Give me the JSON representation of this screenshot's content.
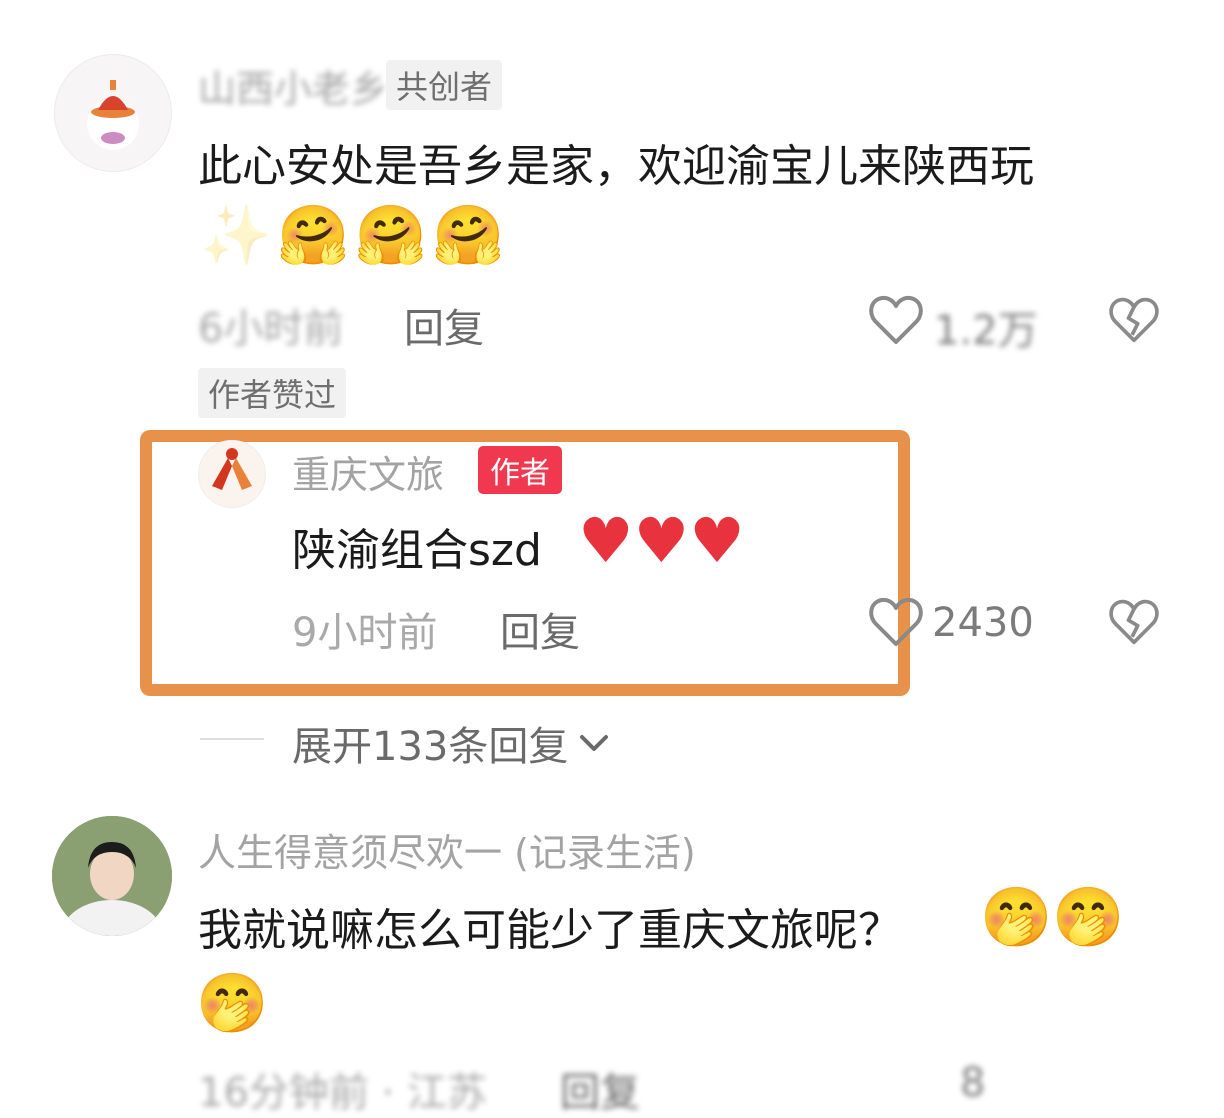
{
  "comments": [
    {
      "username": "山西小老乡",
      "tag": "共创者",
      "text": "此心安处是吾乡是家，欢迎渝宝儿来陕西玩",
      "time": "6小时前",
      "reply_label": "回复",
      "like_count": "1.2万",
      "liked_label": "作者赞过"
    },
    {
      "username": "重庆文旅",
      "tag": "作者",
      "text": "陕渝组合szd",
      "time": "9小时前",
      "reply_label": "回复",
      "like_count": "2430",
      "expand_label": "展开133条回复"
    },
    {
      "username": "人生得意须尽欢一 (记录生活)",
      "text": "我就说嘛怎么可能少了重庆文旅呢？",
      "time": "16分钟前 · 江苏",
      "reply_label": "回复",
      "like_count": "8"
    }
  ],
  "icons": {
    "like": "heart-outline-icon",
    "dislike": "broken-heart-icon",
    "chevron": "chevron-down-icon"
  },
  "colors": {
    "highlight": "#e8914b",
    "author_tag": "#f0384f"
  }
}
